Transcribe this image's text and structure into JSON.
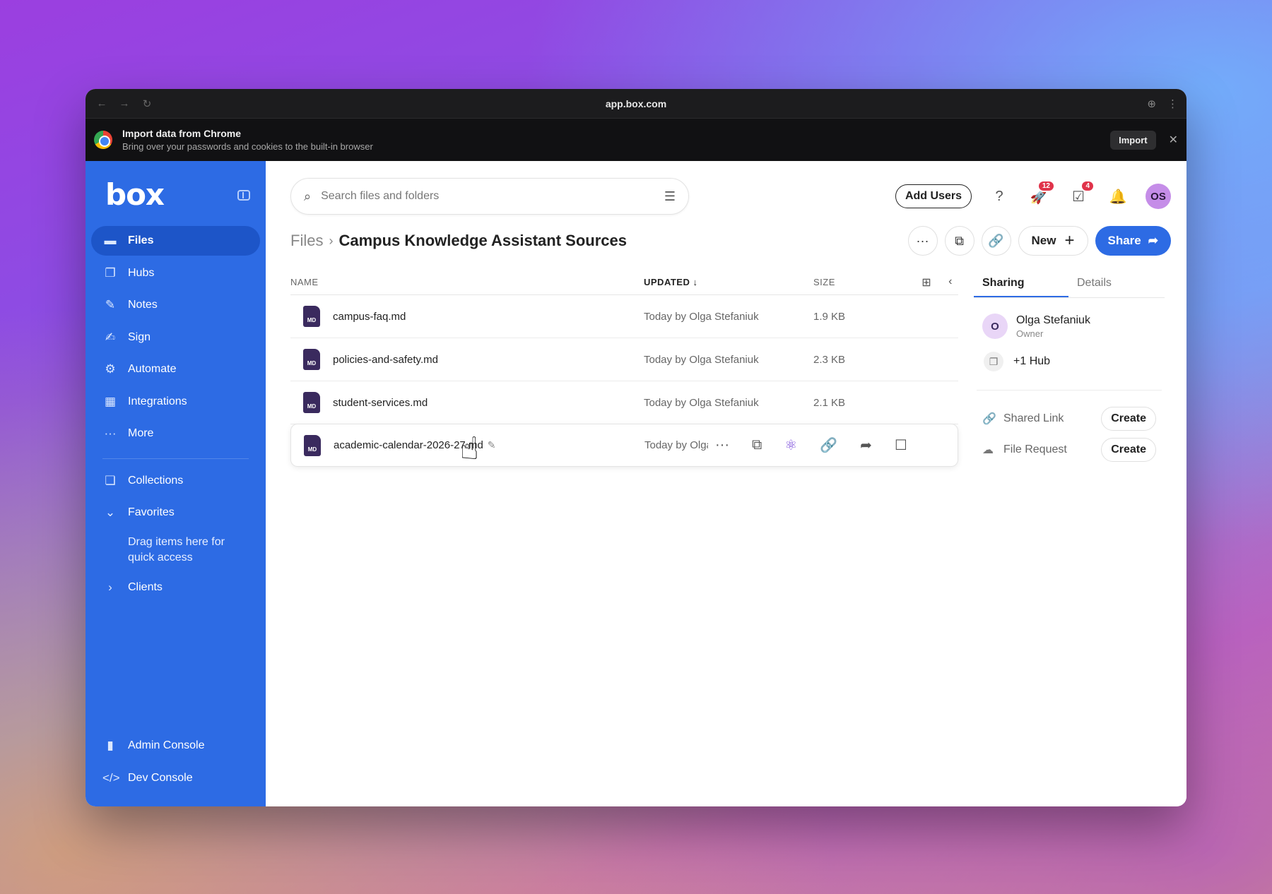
{
  "browser": {
    "url": "app.box.com",
    "import_banner": {
      "title": "Import data from Chrome",
      "subtitle": "Bring over your passwords and cookies to the built-in browser",
      "import_label": "Import"
    }
  },
  "sidebar": {
    "logo": "box",
    "items": [
      {
        "label": "Files",
        "icon": "folder-icon",
        "active": true
      },
      {
        "label": "Hubs",
        "icon": "hubs-icon"
      },
      {
        "label": "Notes",
        "icon": "notes-icon"
      },
      {
        "label": "Sign",
        "icon": "sign-icon"
      },
      {
        "label": "Automate",
        "icon": "automate-icon"
      },
      {
        "label": "Integrations",
        "icon": "integrations-icon"
      },
      {
        "label": "More",
        "icon": "more-icon"
      }
    ],
    "collections": "Collections",
    "favorites": "Favorites",
    "favorites_hint": "Drag items here for quick access",
    "clients": "Clients",
    "admin_console": "Admin Console",
    "dev_console": "Dev Console"
  },
  "header": {
    "search_placeholder": "Search files and folders",
    "add_users": "Add Users",
    "notif_badge": "12",
    "tasks_badge": "4",
    "avatar_initials": "OS"
  },
  "breadcrumb": {
    "root": "Files",
    "current": "Campus Knowledge Assistant Sources"
  },
  "actions": {
    "new_label": "New",
    "share_label": "Share"
  },
  "list": {
    "headers": {
      "name": "NAME",
      "updated": "UPDATED",
      "size": "SIZE"
    },
    "files": [
      {
        "name": "campus-faq.md",
        "updated": "Today by Olga Stefaniuk",
        "size": "1.9 KB"
      },
      {
        "name": "policies-and-safety.md",
        "updated": "Today by Olga Stefaniuk",
        "size": "2.3 KB"
      },
      {
        "name": "student-services.md",
        "updated": "Today by Olga Stefaniuk",
        "size": "2.1 KB"
      },
      {
        "name": "academic-calendar-2026-27.md",
        "updated": "Today by Olga S",
        "size": ""
      }
    ],
    "file_type_label": "MD"
  },
  "panel": {
    "tabs": [
      "Sharing",
      "Details"
    ],
    "owner_name": "Olga Stefaniuk",
    "owner_role": "Owner",
    "owner_initial": "O",
    "hub": "+1 Hub",
    "shared_link": "Shared Link",
    "file_request": "File Request",
    "create_label": "Create"
  },
  "colors": {
    "accent": "#2d6be4",
    "sidebar": "#2d6be4",
    "badge": "#e0334a"
  }
}
